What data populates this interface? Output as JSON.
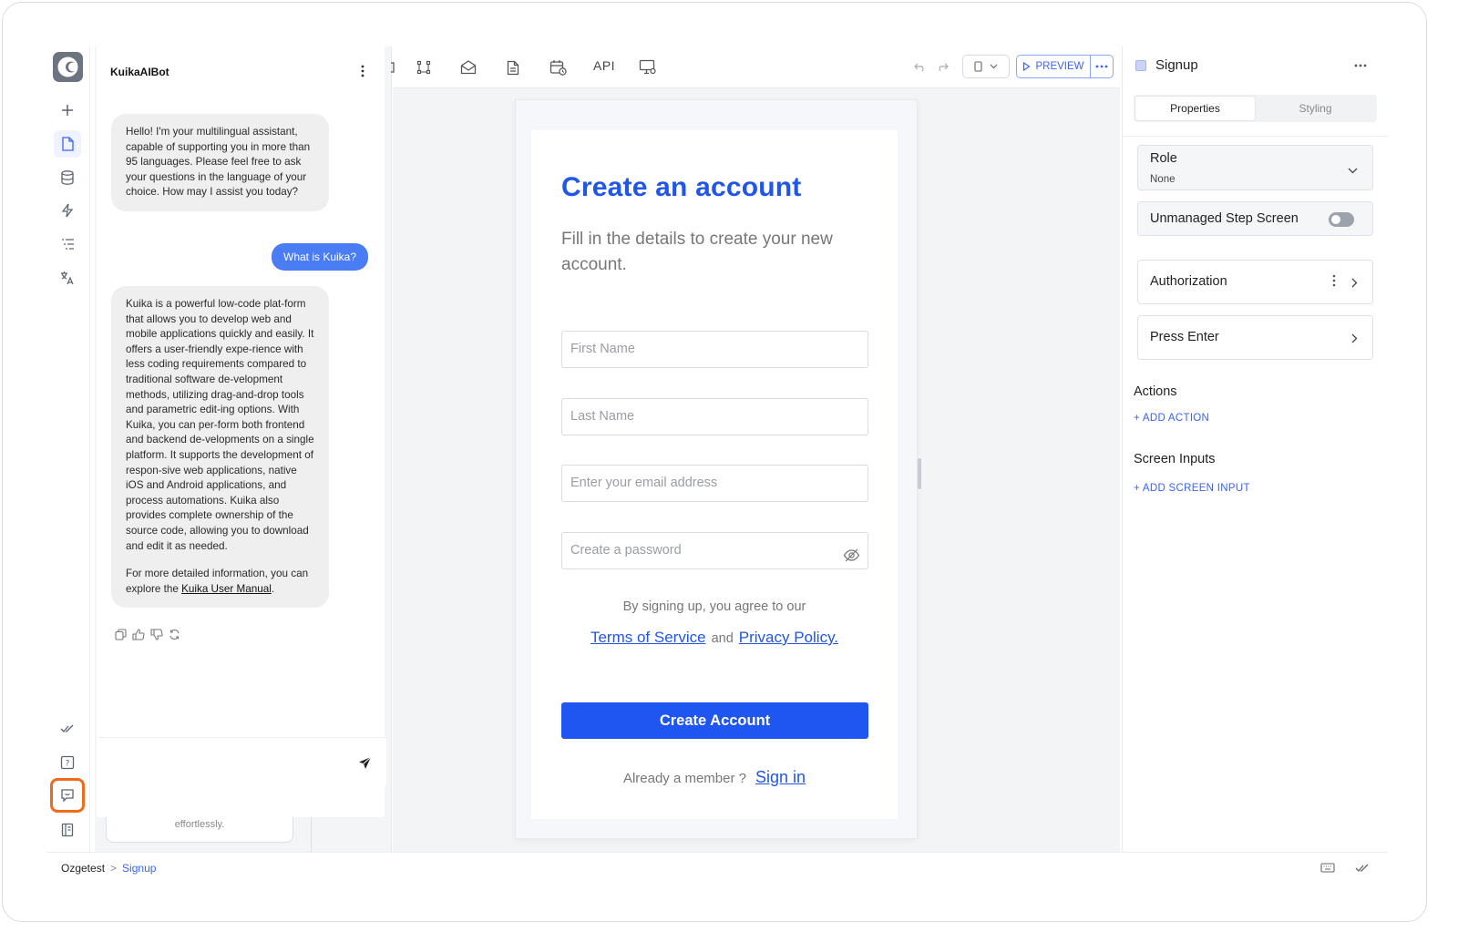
{
  "chat": {
    "title": "KuikaAIBot",
    "greeting": "Hello! I'm your multilingual assistant, capable of supporting you in more than 95 languages. Please feel free to ask your questions in the language of your choice. How may I assist you today?",
    "user_message": "What is Kuika?",
    "answer_p1": "Kuika is a powerful low-code plat-form that allows you to develop web and mobile applications quickly and easily. It offers a user-friendly expe-rience with less coding requirements compared to traditional software de-velopment methods, utilizing drag-and-drop tools and parametric edit-ing options. With Kuika, you can per-form both frontend and backend de-velopments on a single platform. It supports the development of respon-sive web applications, native iOS and Android applications, and process automations. Kuika also provides complete ownership of the source code, allowing you to download and edit it as needed.",
    "answer_p2_prefix": "For more detailed information, you can explore the ",
    "answer_link": "Kuika User Manual",
    "answer_p2_suffix": ".",
    "ghost_text": "effortlessly."
  },
  "toolbar": {
    "api_label": "API",
    "preview_label": "PREVIEW"
  },
  "form": {
    "title": "Create an account",
    "subtitle": "Fill in the details to create your new account.",
    "first_name_placeholder": "First Name",
    "last_name_placeholder": "Last Name",
    "email_placeholder": "Enter your email address",
    "password_placeholder": "Create a password",
    "agree_text": "By signing up, you agree to our",
    "terms_link": "Terms of Service",
    "and_text": "and",
    "privacy_link": "Privacy Policy.",
    "cta_label": "Create Account",
    "member_text": "Already a member ?",
    "signin_link": "Sign in"
  },
  "props": {
    "screen_name": "Signup",
    "tab_properties": "Properties",
    "tab_styling": "Styling",
    "role_label": "Role",
    "role_value": "None",
    "unmanaged_label": "Unmanaged Step Screen",
    "authorization_label": "Authorization",
    "press_enter_label": "Press Enter",
    "actions_label": "Actions",
    "add_action": "+ ADD ACTION",
    "screen_inputs_label": "Screen Inputs",
    "add_screen_input": "+ ADD SCREEN INPUT"
  },
  "breadcrumb": {
    "project": "Ozgetest",
    "separator": ">",
    "current": "Signup"
  },
  "colors": {
    "brand_blue": "#2157e8",
    "highlight_orange": "#f06a1a",
    "user_bubble": "#4a7cf4"
  }
}
